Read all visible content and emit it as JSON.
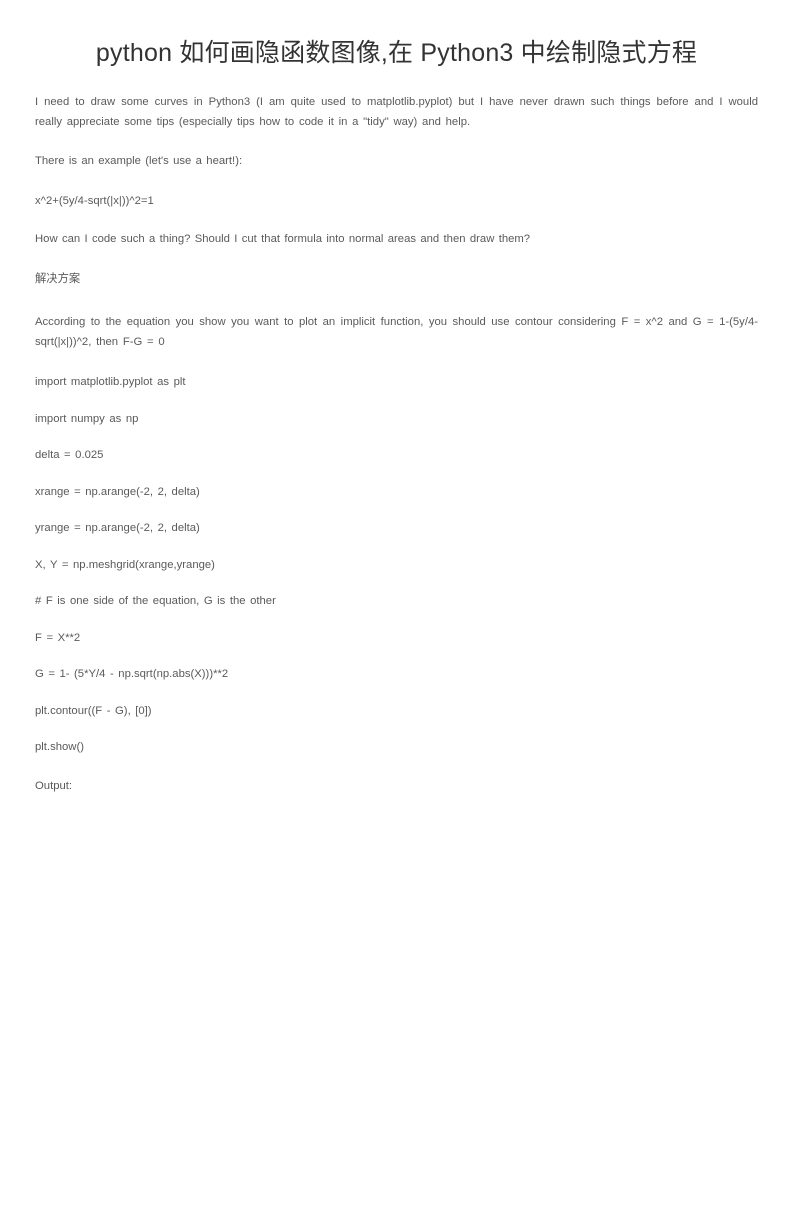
{
  "document": {
    "title": "python 如何画隐函数图像,在 Python3 中绘制隐式方程",
    "intro_paragraph": "I need to draw some curves in Python3 (I am quite used to matplotlib.pyplot) but I have never drawn such things before and I would really appreciate some tips (especially tips how to code it in a \"tidy\" way) and help.",
    "example_intro": "There is an example (let's use a heart!):",
    "equation": "x^2+(5y/4-sqrt(|x|))^2=1",
    "question": "How can I code such a thing? Should I cut that formula into normal areas and then draw them?",
    "solution_heading": "解决方案",
    "solution_paragraph": "According to the equation you show you want to plot an implicit function, you should use contour considering F = x^2 and G = 1-(5y/4-sqrt(|x|))^2, then F-G = 0",
    "code_lines": [
      "import matplotlib.pyplot as plt",
      "import numpy as np",
      "delta = 0.025",
      "xrange = np.arange(-2, 2, delta)",
      "yrange = np.arange(-2, 2, delta)",
      "X, Y = np.meshgrid(xrange,yrange)",
      "# F is one side of the equation, G is the other",
      "F = X**2",
      "G = 1- (5*Y/4 - np.sqrt(np.abs(X)))**2",
      "plt.contour((F - G), [0])",
      "plt.show()"
    ],
    "output_label": "Output:"
  },
  "colors": {
    "page_background": "#ffffff",
    "title_text": "#333333",
    "body_text": "#5a5a5a"
  }
}
